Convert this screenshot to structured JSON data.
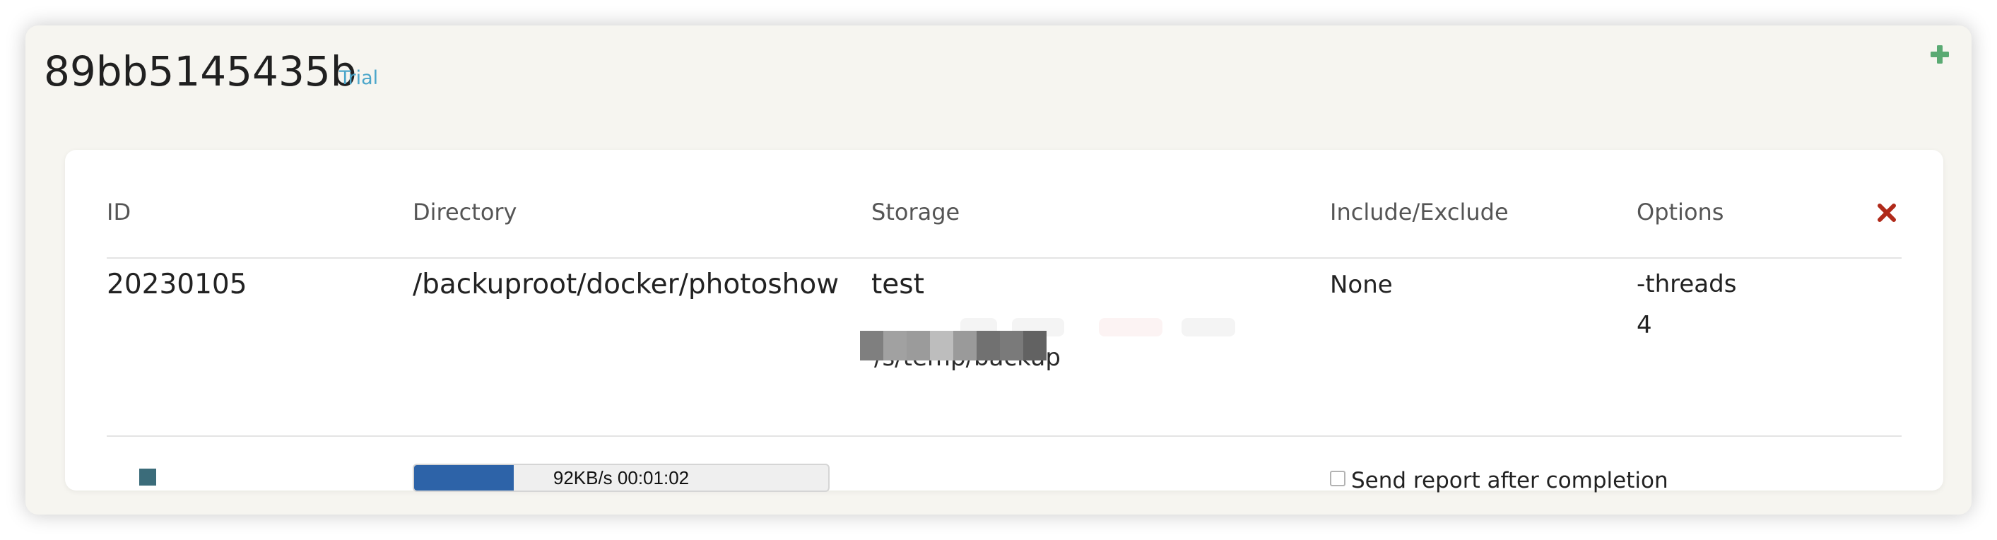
{
  "repository": {
    "title": "89bb5145435b",
    "license": "Trial"
  },
  "table": {
    "headers": {
      "id": "ID",
      "directory": "Directory",
      "storage": "Storage",
      "include_exclude": "Include/Exclude",
      "options": "Options"
    },
    "row": {
      "id": "20230105",
      "directory": "/backuproot/docker/photoshow",
      "storage_name": "test",
      "storage_path_visible": "/s/temp/backup",
      "include_exclude": "None",
      "options_line_1": "-threads",
      "options_line_2": "4"
    }
  },
  "progress": {
    "text": "92KB/s 00:01:02",
    "percent": 24
  },
  "report": {
    "label": "Send report after completion",
    "checked": false
  },
  "icons": {
    "add": "plus-icon",
    "remove": "close-icon",
    "status": "stop-icon"
  },
  "colors": {
    "panel_background": "#f6f5f0",
    "card_background": "#ffffff",
    "license_blue": "#4ba6ca",
    "add_green": "#5aaa73",
    "remove_red": "#b02a1a",
    "progress_blue": "#2d63a8",
    "status_teal": "#3b6c7a"
  }
}
